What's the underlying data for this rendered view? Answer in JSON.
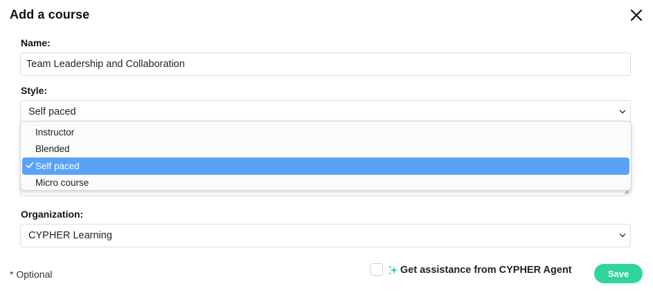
{
  "dialog": {
    "title": "Add a course",
    "close_icon": "close-icon"
  },
  "form": {
    "name_label": "Name:",
    "name_value": "Team Leadership and Collaboration",
    "style_label": "Style:",
    "style_value": "Self paced",
    "style_options": [
      "Instructor",
      "Blended",
      "Self paced",
      "Micro course"
    ],
    "style_selected_index": 2,
    "organization_label": "Organization:",
    "organization_value": "CYPHER Learning"
  },
  "footer": {
    "optional_note": "* Optional",
    "assist_label": "Get assistance from CYPHER Agent",
    "assist_checked": false,
    "assist_icon": "sparkle-icon",
    "save_label": "Save"
  },
  "colors": {
    "selected_option": "#5aa2f7",
    "save_button": "#2fd4a0",
    "sparkle": "#2fd4a0"
  }
}
